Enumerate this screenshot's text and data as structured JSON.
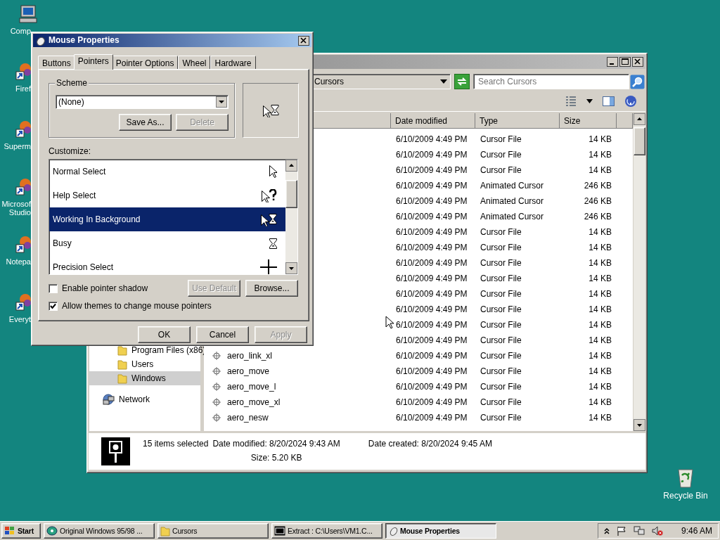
{
  "desktop_icons": [
    {
      "label": "Comp",
      "kind": "computer"
    },
    {
      "label": "Firef",
      "kind": "shortcut"
    },
    {
      "label": "Superm",
      "kind": "shortcut"
    },
    {
      "label": "Microsof Studio",
      "kind": "shortcut"
    },
    {
      "label": "Notepa",
      "kind": "shortcut"
    },
    {
      "label": "Everyt",
      "kind": "shortcut"
    }
  ],
  "recycle_bin": {
    "label": "Recycle Bin"
  },
  "explorer": {
    "address": "Cursors",
    "search": {
      "placeholder": "Search Cursors"
    },
    "columns": [
      "Date modified",
      "Type",
      "Size"
    ],
    "rows": [
      {
        "date": "6/10/2009 4:49 PM",
        "type": "Cursor File",
        "size": "14 KB"
      },
      {
        "date": "6/10/2009 4:49 PM",
        "type": "Cursor File",
        "size": "14 KB"
      },
      {
        "date": "6/10/2009 4:49 PM",
        "type": "Cursor File",
        "size": "14 KB"
      },
      {
        "date": "6/10/2009 4:49 PM",
        "type": "Animated Cursor",
        "size": "246 KB"
      },
      {
        "date": "6/10/2009 4:49 PM",
        "type": "Animated Cursor",
        "size": "246 KB"
      },
      {
        "date": "6/10/2009 4:49 PM",
        "type": "Animated Cursor",
        "size": "246 KB"
      },
      {
        "date": "6/10/2009 4:49 PM",
        "type": "Cursor File",
        "size": "14 KB"
      },
      {
        "date": "6/10/2009 4:49 PM",
        "type": "Cursor File",
        "size": "14 KB"
      },
      {
        "date": "6/10/2009 4:49 PM",
        "type": "Cursor File",
        "size": "14 KB"
      },
      {
        "date": "6/10/2009 4:49 PM",
        "type": "Cursor File",
        "size": "14 KB"
      },
      {
        "date": "6/10/2009 4:49 PM",
        "type": "Cursor File",
        "size": "14 KB"
      },
      {
        "date": "6/10/2009 4:49 PM",
        "type": "Cursor File",
        "size": "14 KB"
      },
      {
        "date": "6/10/2009 4:49 PM",
        "type": "Cursor File",
        "size": "14 KB"
      },
      {
        "date": "6/10/2009 4:49 PM",
        "type": "Cursor File",
        "size": "14 KB"
      },
      {
        "name": "aero_link_xl",
        "date": "6/10/2009 4:49 PM",
        "type": "Cursor File",
        "size": "14 KB"
      },
      {
        "name": "aero_move",
        "date": "6/10/2009 4:49 PM",
        "type": "Cursor File",
        "size": "14 KB"
      },
      {
        "name": "aero_move_l",
        "date": "6/10/2009 4:49 PM",
        "type": "Cursor File",
        "size": "14 KB"
      },
      {
        "name": "aero_move_xl",
        "date": "6/10/2009 4:49 PM",
        "type": "Cursor File",
        "size": "14 KB"
      },
      {
        "name": "aero_nesw",
        "date": "6/10/2009 4:49 PM",
        "type": "Cursor File",
        "size": "14 KB"
      }
    ],
    "nav": [
      {
        "label": "Program Files (x86)",
        "kind": "folder",
        "selected": false
      },
      {
        "label": "Users",
        "kind": "folder",
        "selected": false
      },
      {
        "label": "Windows",
        "kind": "folder",
        "selected": true
      },
      {
        "label": "Network",
        "kind": "network",
        "selected": false
      }
    ],
    "details": {
      "summary": "15 items selected",
      "modified": "Date modified: 8/20/2024 9:43 AM",
      "size": "Size: 5.20 KB",
      "created": "Date created: 8/20/2024 9:45 AM"
    }
  },
  "dialog": {
    "title": "Mouse Properties",
    "tabs": [
      {
        "label": "Buttons",
        "selected": false
      },
      {
        "label": "Pointers",
        "selected": true
      },
      {
        "label": "Pointer Options",
        "selected": false
      },
      {
        "label": "Wheel",
        "selected": false
      },
      {
        "label": "Hardware",
        "selected": false
      }
    ],
    "scheme": {
      "label": "Scheme",
      "value": "(None)"
    },
    "scheme_buttons": [
      {
        "label": "Save As...",
        "disabled": false
      },
      {
        "label": "Delete",
        "disabled": true
      }
    ],
    "customize_label": "Customize:",
    "pointers": [
      {
        "label": "Normal Select",
        "kind": "arrow",
        "selected": false
      },
      {
        "label": "Help Select",
        "kind": "help",
        "selected": false
      },
      {
        "label": "Working In Background",
        "kind": "working",
        "selected": true
      },
      {
        "label": "Busy",
        "kind": "busy",
        "selected": false
      },
      {
        "label": "Precision Select",
        "kind": "cross",
        "selected": false
      }
    ],
    "shadow": {
      "label": "Enable pointer shadow",
      "checked": false
    },
    "pointer_buttons": [
      {
        "label": "Use Default",
        "disabled": true
      },
      {
        "label": "Browse...",
        "disabled": false
      }
    ],
    "themes": {
      "label": "Allow themes to change mouse pointers",
      "checked": true
    },
    "buttons": [
      {
        "label": "OK",
        "disabled": false
      },
      {
        "label": "Cancel",
        "disabled": false
      },
      {
        "label": "Apply",
        "disabled": true
      }
    ]
  },
  "taskbar": {
    "start": "Start",
    "tasks": [
      {
        "label": "Original Windows 95/98 ...",
        "kind": "disc",
        "selected": false
      },
      {
        "label": "Cursors",
        "kind": "folder",
        "selected": false
      },
      {
        "label": "Extract : C:\\Users\\VM1.C...",
        "kind": "archive",
        "selected": false
      },
      {
        "label": "Mouse Properties",
        "kind": "mouse",
        "selected": true
      }
    ],
    "clock": "9:46 AM"
  }
}
